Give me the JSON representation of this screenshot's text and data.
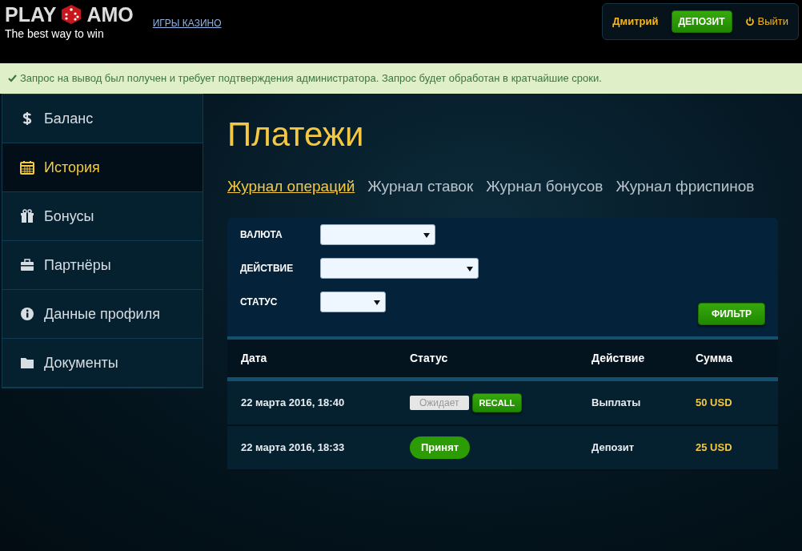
{
  "header": {
    "logo_left": "PLAY",
    "logo_right": "AMO",
    "tagline": "The best way to win",
    "nav_link": "ИГРЫ КАЗИНО",
    "user": "Дмитрий",
    "deposit_button": "ДЕПОЗИТ",
    "logout": "Выйти"
  },
  "alert": "Запрос на вывод был получен и требует подтверждения администратора. Запрос будет обработан в кратчайшие сроки.",
  "sidebar": {
    "items": [
      {
        "label": "Баланс",
        "selected": false
      },
      {
        "label": "История",
        "selected": true
      },
      {
        "label": "Бонусы",
        "selected": false
      },
      {
        "label": "Партнёры",
        "selected": false
      },
      {
        "label": "Данные профиля",
        "selected": false
      },
      {
        "label": "Документы",
        "selected": false
      }
    ]
  },
  "page_title": "Платежи",
  "tabs": [
    {
      "label": "Журнал операций",
      "selected": true
    },
    {
      "label": "Журнал ставок",
      "selected": false
    },
    {
      "label": "Журнал бонусов",
      "selected": false
    },
    {
      "label": "Журнал фриспинов",
      "selected": false
    }
  ],
  "filters": [
    {
      "label": "ВАЛЮТА"
    },
    {
      "label": "ДЕЙСТВИЕ"
    },
    {
      "label": "СТАТУС"
    }
  ],
  "filter_button": "ФИЛЬТР",
  "table": {
    "columns": [
      "Дата",
      "Статус",
      "Действие",
      "Сумма"
    ],
    "rows": [
      {
        "date": "22 марта 2016, 18:40",
        "status": {
          "kind": "pending",
          "label": "Ожидает",
          "button": "RECALL"
        },
        "action": "Выплаты",
        "amount": "50 USD"
      },
      {
        "date": "22 марта 2016, 18:33",
        "status": {
          "kind": "accepted",
          "label": "Принят"
        },
        "action": "Депозит",
        "amount": "25 USD"
      }
    ]
  }
}
